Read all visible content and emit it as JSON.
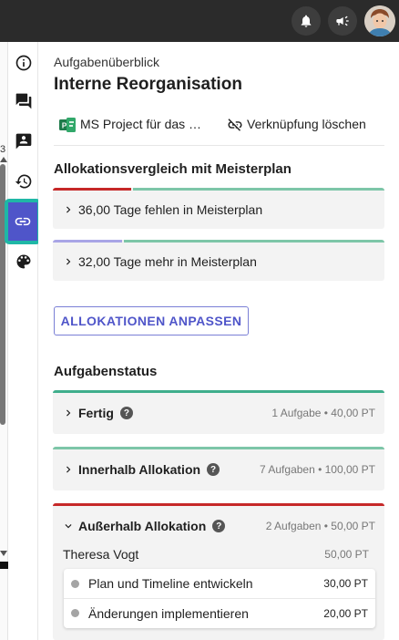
{
  "header": {
    "icons": [
      "bell-icon",
      "megaphone-icon"
    ],
    "avatar": "user-avatar"
  },
  "edge": {
    "number": "3"
  },
  "rail": {
    "items": [
      "info-icon",
      "chat-icon",
      "contact-card-icon",
      "history-icon",
      "link-icon",
      "palette-icon"
    ],
    "active": "link-icon"
  },
  "panel": {
    "overview_label": "Aufgabenüberblick",
    "title": "Interne Reorganisation",
    "project_link": "MS Project für das …",
    "unlink_label": "Verknüpfung löschen"
  },
  "allocation": {
    "title": "Allokationsvergleich mit Meisterplan",
    "items": [
      {
        "label": "36,00 Tage fehlen in Meisterplan"
      },
      {
        "label": "32,00 Tage mehr in Meisterplan"
      }
    ],
    "adjust_button": "ALLOKATIONEN ANPASSEN"
  },
  "status": {
    "title": "Aufgabenstatus",
    "groups": [
      {
        "label": "Fertig",
        "meta": "1 Aufgabe • 40,00 PT"
      },
      {
        "label": "Innerhalb Allokation",
        "meta": "7 Aufgaben • 100,00 PT"
      },
      {
        "label": "Außerhalb Allokation",
        "meta": "2 Aufgaben • 50,00 PT"
      }
    ],
    "person": {
      "name": "Theresa Vogt",
      "value": "50,00 PT"
    },
    "tasks": [
      {
        "name": "Plan und Timeline entwickeln",
        "value": "30,00 PT"
      },
      {
        "name": "Änderungen implementieren",
        "value": "20,00 PT"
      }
    ]
  },
  "colors": {
    "teal": "#3fae8c",
    "red": "#c62828",
    "lavender": "#a9a5e6",
    "accent": "#4f55c9",
    "highlight": "#1fb7a6"
  }
}
